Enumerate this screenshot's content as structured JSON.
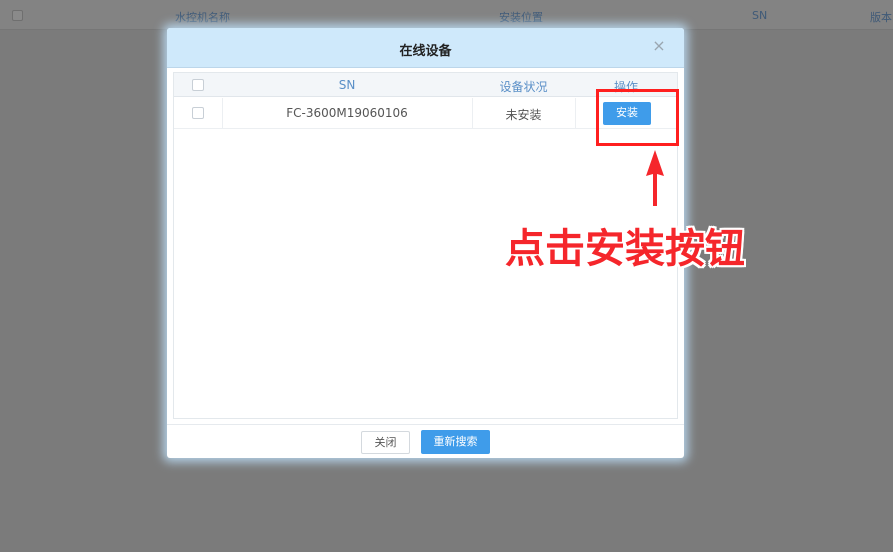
{
  "background": {
    "columns": [
      "水控机名称",
      "安装位置",
      "SN",
      "版本"
    ]
  },
  "modal": {
    "title": "在线设备",
    "close_glyph": "×",
    "table": {
      "headers": {
        "sn": "SN",
        "status": "设备状况",
        "action": "操作"
      },
      "rows": [
        {
          "sn": "FC-3600M19060106",
          "status": "未安装",
          "action_label": "安装"
        }
      ]
    },
    "footer": {
      "close_label": "关闭",
      "research_label": "重新搜索"
    }
  },
  "annotation": {
    "text": "点击安装按钮",
    "color": "#f5262b"
  },
  "colors": {
    "accent": "#3f9cea",
    "header_bg": "#cfe9fb"
  }
}
